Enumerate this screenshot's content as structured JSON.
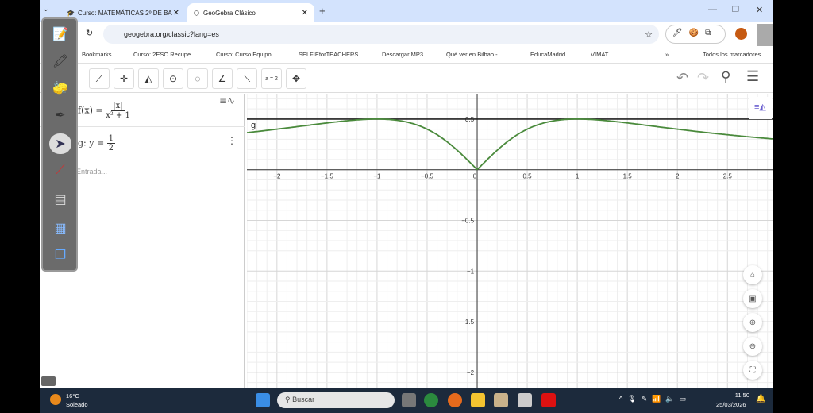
{
  "browser": {
    "tabs": [
      {
        "label": "Curso: MATEMÁTICAS 2º DE BA"
      },
      {
        "label": "GeoGebra Clásico"
      }
    ],
    "new_tab": "+",
    "url": "geogebra.org/classic?lang=es",
    "bookmarks": [
      "Bookmarks",
      "Curso: 2ESO Recupe...",
      "Curso: Curso Equipo...",
      "SELFIEforTEACHERS...",
      "Descargar MP3",
      "Qué ver en Bilbao -...",
      "EducaMadrid",
      "VIMAT"
    ],
    "more": "»",
    "all_bookmarks": "Todos los marcadores"
  },
  "toolbar": {
    "slider_label": "a = 2"
  },
  "algebra": {
    "f": {
      "lhs": "f(x) =",
      "num": "|x|",
      "den": "x² + 1"
    },
    "g": {
      "lhs": "g: y =",
      "num": "1",
      "den": "2"
    },
    "input_placeholder": "Entrada..."
  },
  "chart_data": {
    "type": "line",
    "functions": [
      {
        "name": "f",
        "expr": "|x|/(x^2+1)",
        "color": "#4a8a3c"
      },
      {
        "name": "g",
        "expr": "y = 1/2",
        "value": 0.5,
        "color": "#222222",
        "label": "g"
      }
    ],
    "xlim": [
      -2.3,
      2.95
    ],
    "ylim": [
      -2.15,
      0.75
    ],
    "x_ticks": [
      -2,
      -1.5,
      -1,
      -0.5,
      0,
      0.5,
      1,
      1.5,
      2,
      2.5
    ],
    "x_tick_labels": [
      "−2",
      "−1.5",
      "−1",
      "−0.5",
      "0",
      "0.5",
      "1",
      "1.5",
      "2",
      "2.5"
    ],
    "y_ticks": [
      0.5,
      -0.5,
      -1,
      -1.5,
      -2
    ],
    "y_tick_labels": [
      "0.5",
      "−0.5",
      "−1",
      "−1.5",
      "−2"
    ],
    "grid": true
  },
  "taskbar": {
    "temp": "16°C",
    "weather": "Soleado",
    "search": "Buscar",
    "time": "11:50",
    "date": "25/03/2026"
  }
}
